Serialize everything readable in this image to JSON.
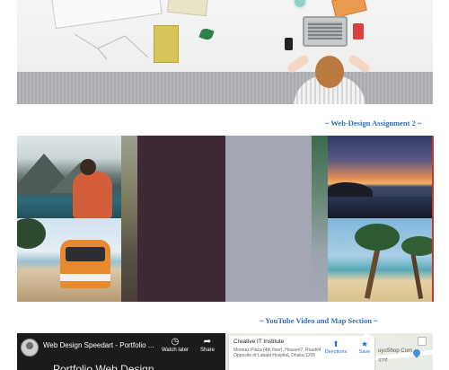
{
  "sections": {
    "assignment_title": "~ Web-Design Assignment 2 ~",
    "video_map_title": "~ YouTube Video and Map Section ~"
  },
  "hero": {
    "alt": "Workspace banner photo"
  },
  "video": {
    "title": "Web Design Speedart - Portfolio ...",
    "watch_later": "Watch later",
    "share": "Share",
    "overlay_text": "Portfolio Web Design",
    "icons": {
      "watch_later": "clock-icon",
      "share": "share-icon"
    }
  },
  "map": {
    "place_name": "Creative IT Institute",
    "address": "Momtaz Plaza (4th floor), House#7, Road#4 Opposite of Labaid Hospital, Dhaka 1205",
    "directions": "Directions",
    "save": "Save",
    "poi_label_1": "uyoShop Com",
    "poi_label_2": "বাসা",
    "icons": {
      "directions": "directions-icon",
      "save": "star-icon"
    },
    "colors": {
      "accent": "#1a73e8"
    }
  },
  "colors": {
    "section_title": "#2f6fb7",
    "gallery_dark": "#3e2936",
    "gallery_gray": "#a4a7b3"
  }
}
